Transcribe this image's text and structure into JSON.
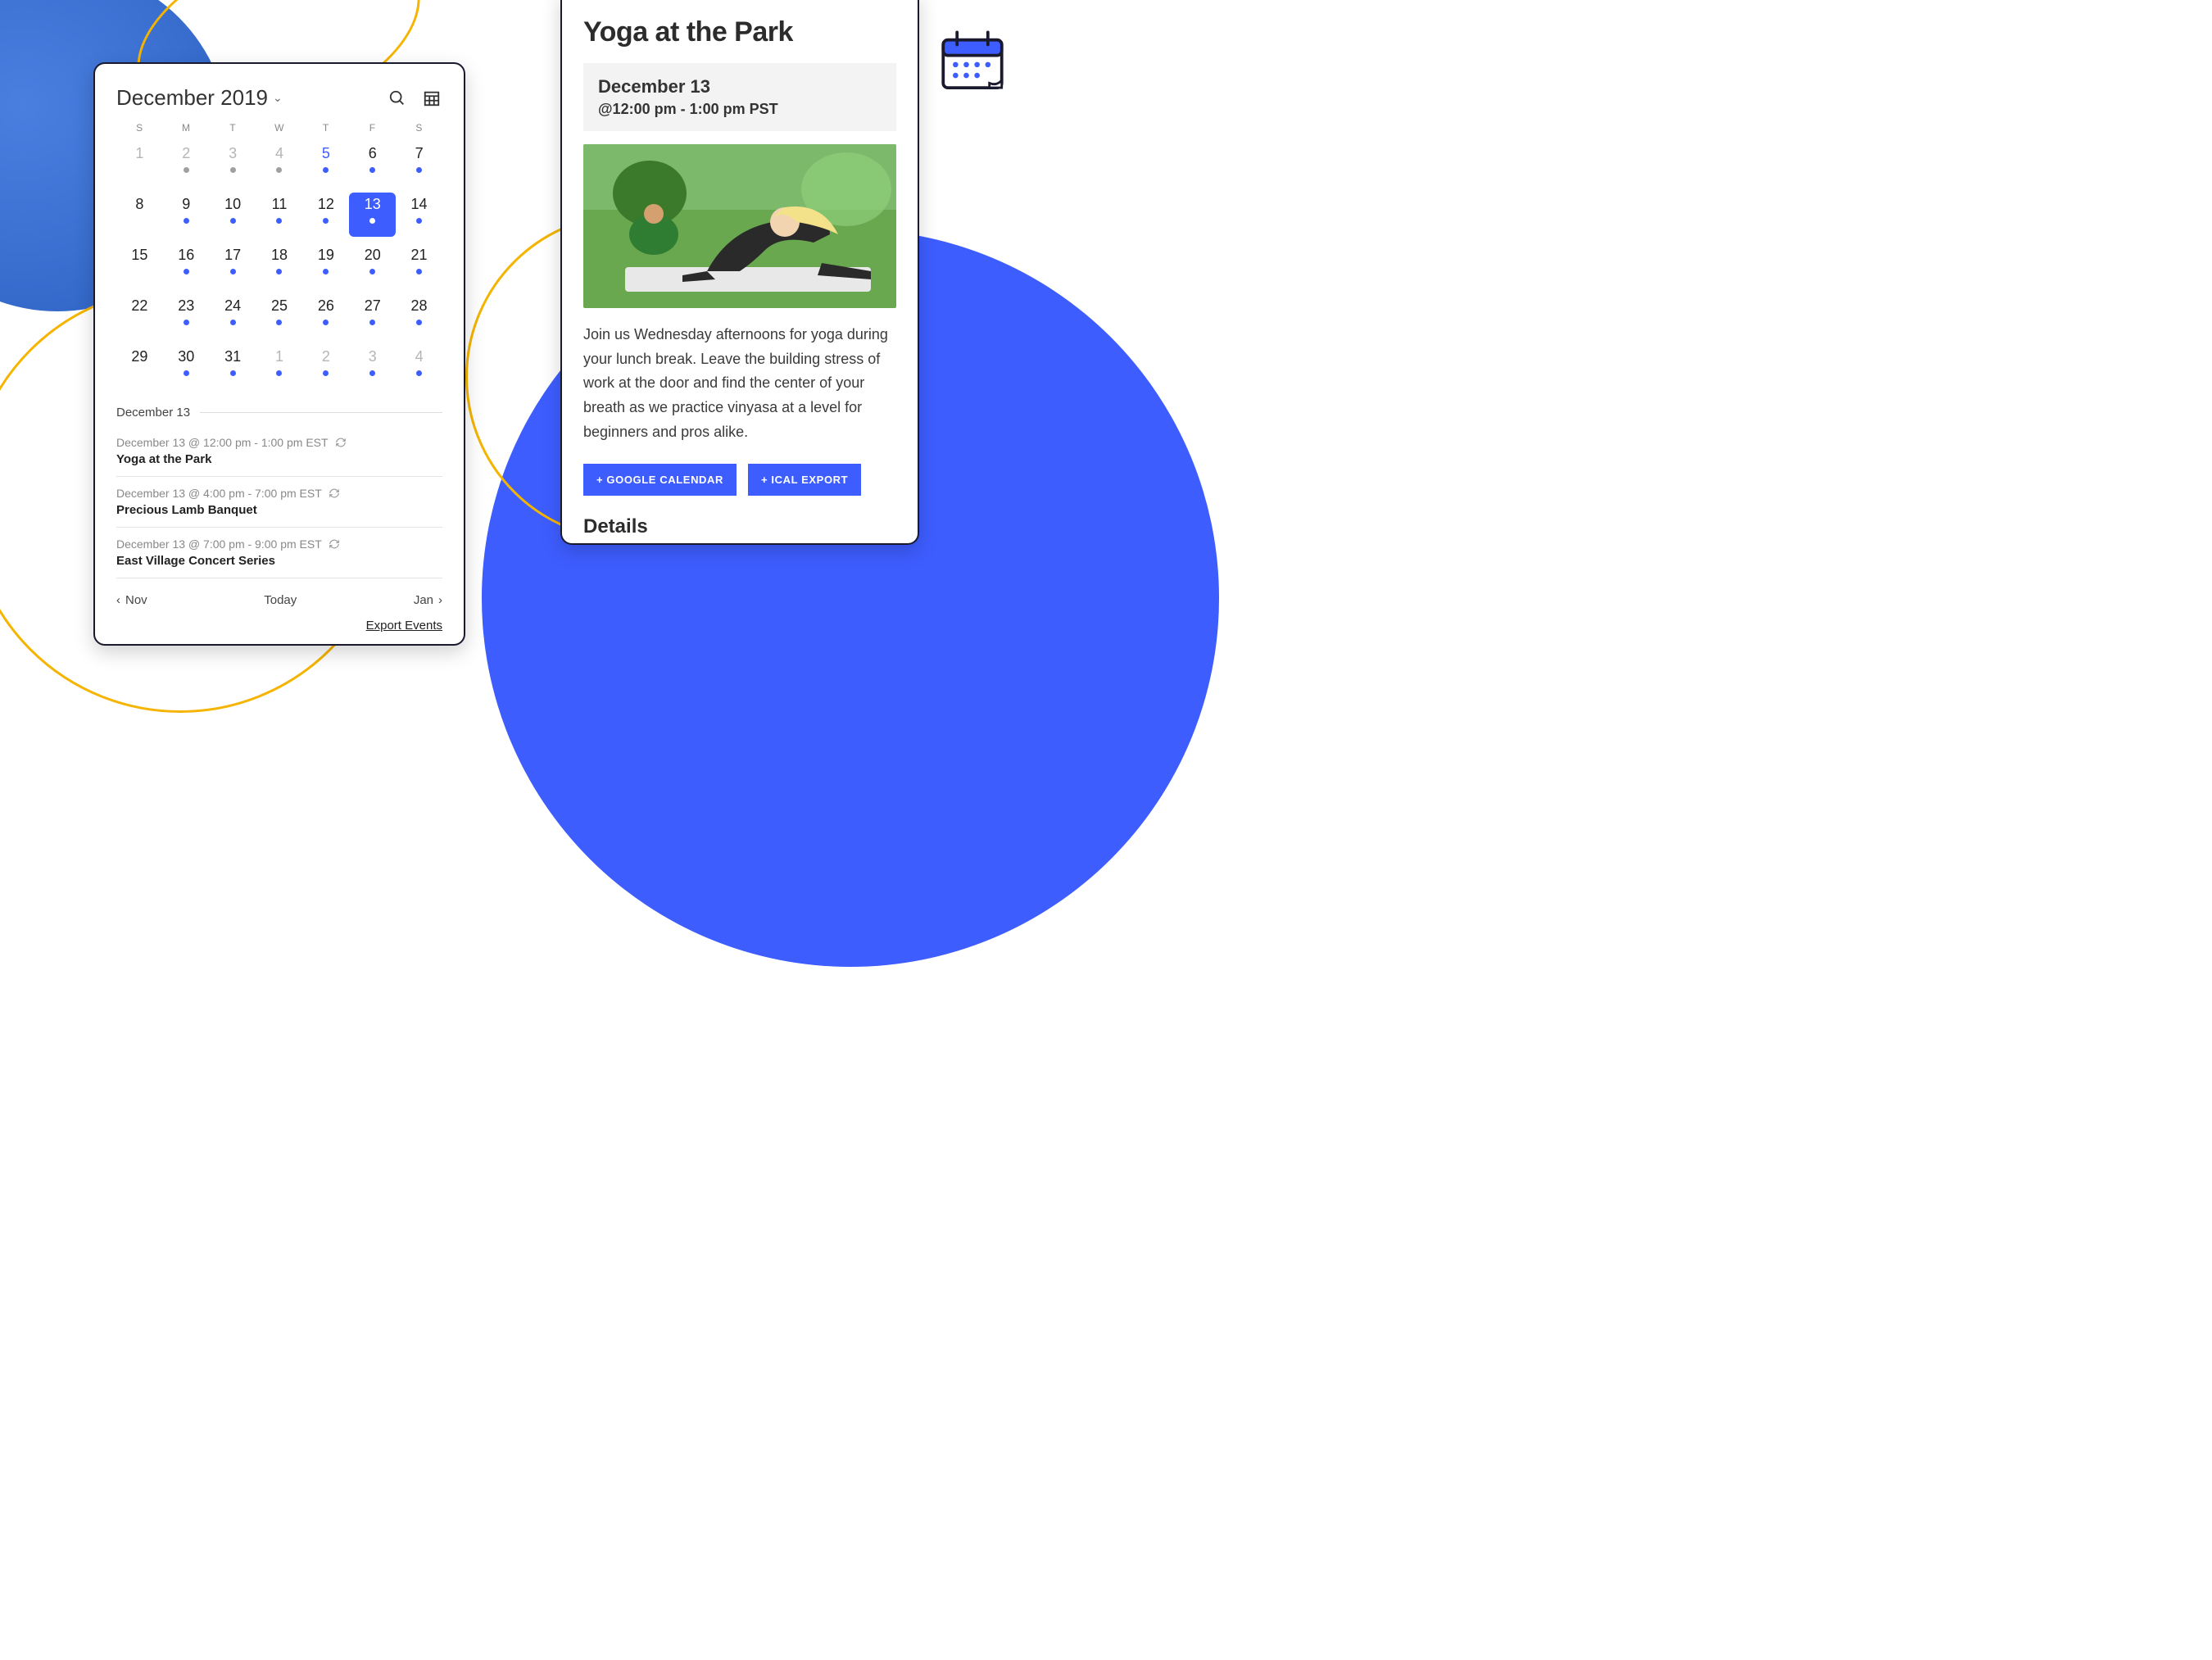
{
  "calendar": {
    "title": "December 2019",
    "dow": [
      "S",
      "M",
      "T",
      "W",
      "T",
      "F",
      "S"
    ],
    "days": [
      {
        "n": "1",
        "out": true
      },
      {
        "n": "2",
        "out": true,
        "dot": "grey"
      },
      {
        "n": "3",
        "out": true,
        "dot": "grey"
      },
      {
        "n": "4",
        "out": true,
        "dot": "grey"
      },
      {
        "n": "5",
        "accent": true,
        "dot": "blue"
      },
      {
        "n": "6",
        "dot": "blue"
      },
      {
        "n": "7",
        "dot": "blue"
      },
      {
        "n": "8"
      },
      {
        "n": "9",
        "dot": "blue"
      },
      {
        "n": "10",
        "dot": "blue"
      },
      {
        "n": "11",
        "dot": "blue"
      },
      {
        "n": "12",
        "dot": "blue"
      },
      {
        "n": "13",
        "selected": true,
        "dot": "white"
      },
      {
        "n": "14",
        "dot": "blue"
      },
      {
        "n": "15"
      },
      {
        "n": "16",
        "dot": "blue"
      },
      {
        "n": "17",
        "dot": "blue"
      },
      {
        "n": "18",
        "dot": "blue"
      },
      {
        "n": "19",
        "dot": "blue"
      },
      {
        "n": "20",
        "dot": "blue"
      },
      {
        "n": "21",
        "dot": "blue"
      },
      {
        "n": "22"
      },
      {
        "n": "23",
        "dot": "blue"
      },
      {
        "n": "24",
        "dot": "blue"
      },
      {
        "n": "25",
        "dot": "blue"
      },
      {
        "n": "26",
        "dot": "blue"
      },
      {
        "n": "27",
        "dot": "blue"
      },
      {
        "n": "28",
        "dot": "blue"
      },
      {
        "n": "29"
      },
      {
        "n": "30",
        "dot": "blue"
      },
      {
        "n": "31",
        "dot": "blue"
      },
      {
        "n": "1",
        "out": true,
        "dot": "blue"
      },
      {
        "n": "2",
        "out": true,
        "dot": "blue"
      },
      {
        "n": "3",
        "out": true,
        "dot": "blue"
      },
      {
        "n": "4",
        "out": true,
        "dot": "blue"
      }
    ],
    "selected_heading": "December 13",
    "events": [
      {
        "time": "December 13 @ 12:00 pm - 1:00 pm EST",
        "title": "Yoga at the Park",
        "recurring": true
      },
      {
        "time": "December 13 @ 4:00 pm - 7:00 pm EST",
        "title": "Precious Lamb Banquet",
        "recurring": true
      },
      {
        "time": "December 13 @ 7:00 pm - 9:00 pm EST",
        "title": "East Village Concert Series",
        "recurring": true
      }
    ],
    "nav": {
      "prev": "Nov",
      "today": "Today",
      "next": "Jan"
    },
    "export_label": "Export Events"
  },
  "detail": {
    "title": "Yoga at the Park",
    "date": "December 13",
    "time": "@12:00 pm - 1:00 pm PST",
    "description": "Join us Wednesday afternoons for yoga during your lunch break.  Leave the building stress of work at the door and find the center of your breath as we practice vinyasa at a level for beginners and pros alike.",
    "buttons": {
      "gcal": "+ GOOGLE CALENDAR",
      "ical": "+ ICAL EXPORT"
    },
    "details_heading": "Details"
  }
}
